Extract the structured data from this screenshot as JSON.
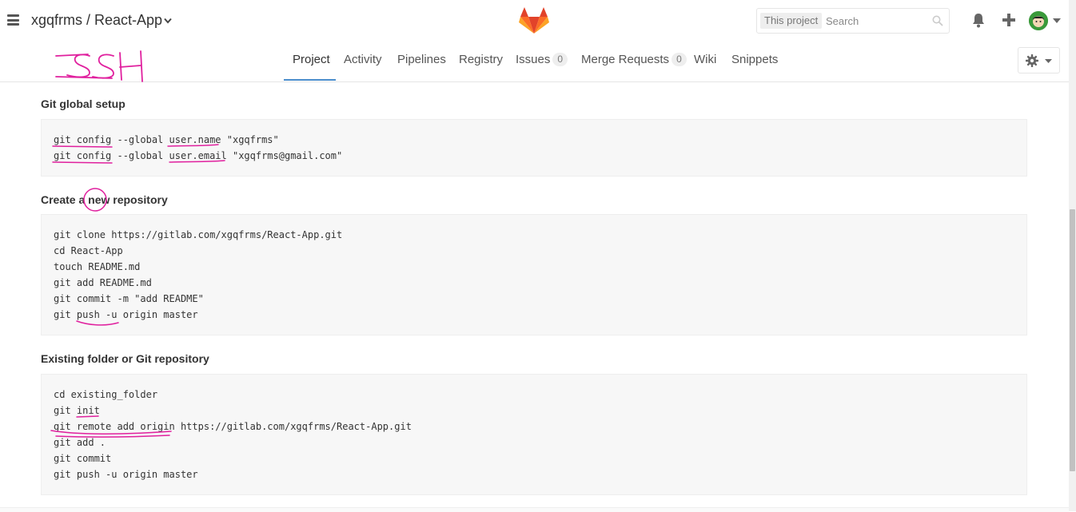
{
  "header": {
    "project_title": "xgqfrms / React-App",
    "search_scope": "This project",
    "search_placeholder": "Search",
    "colors": {
      "logo_orange": "#e2432a",
      "logo_light": "#fca326",
      "logo_mid": "#fc6d26"
    }
  },
  "nav": {
    "tabs": [
      {
        "label": "Project",
        "active": true
      },
      {
        "label": "Activity"
      },
      {
        "label": "Pipelines"
      },
      {
        "label": "Registry"
      },
      {
        "label": "Issues",
        "count": "0"
      },
      {
        "label": "Merge Requests",
        "count": "0"
      },
      {
        "label": "Wiki"
      },
      {
        "label": "Snippets"
      }
    ],
    "active_color": "#4b8dcc"
  },
  "sections": [
    {
      "title": "Git global setup",
      "lines": [
        "git config --global user.name \"xgqfrms\"",
        "git config --global user.email \"xgqfrms@gmail.com\""
      ]
    },
    {
      "title": "Create a new repository",
      "lines": [
        "git clone https://gitlab.com/xgqfrms/React-App.git",
        "cd React-App",
        "touch README.md",
        "git add README.md",
        "git commit -m \"add README\"",
        "git push -u origin master"
      ]
    },
    {
      "title": "Existing folder or Git repository",
      "lines": [
        "cd existing_folder",
        "git init",
        "git remote add origin https://gitlab.com/xgqfrms/React-App.git",
        "git add .",
        "git commit",
        "git push -u origin master"
      ]
    }
  ],
  "annotation": {
    "handwritten_text": "SSH",
    "ink_color": "#e0209e"
  }
}
